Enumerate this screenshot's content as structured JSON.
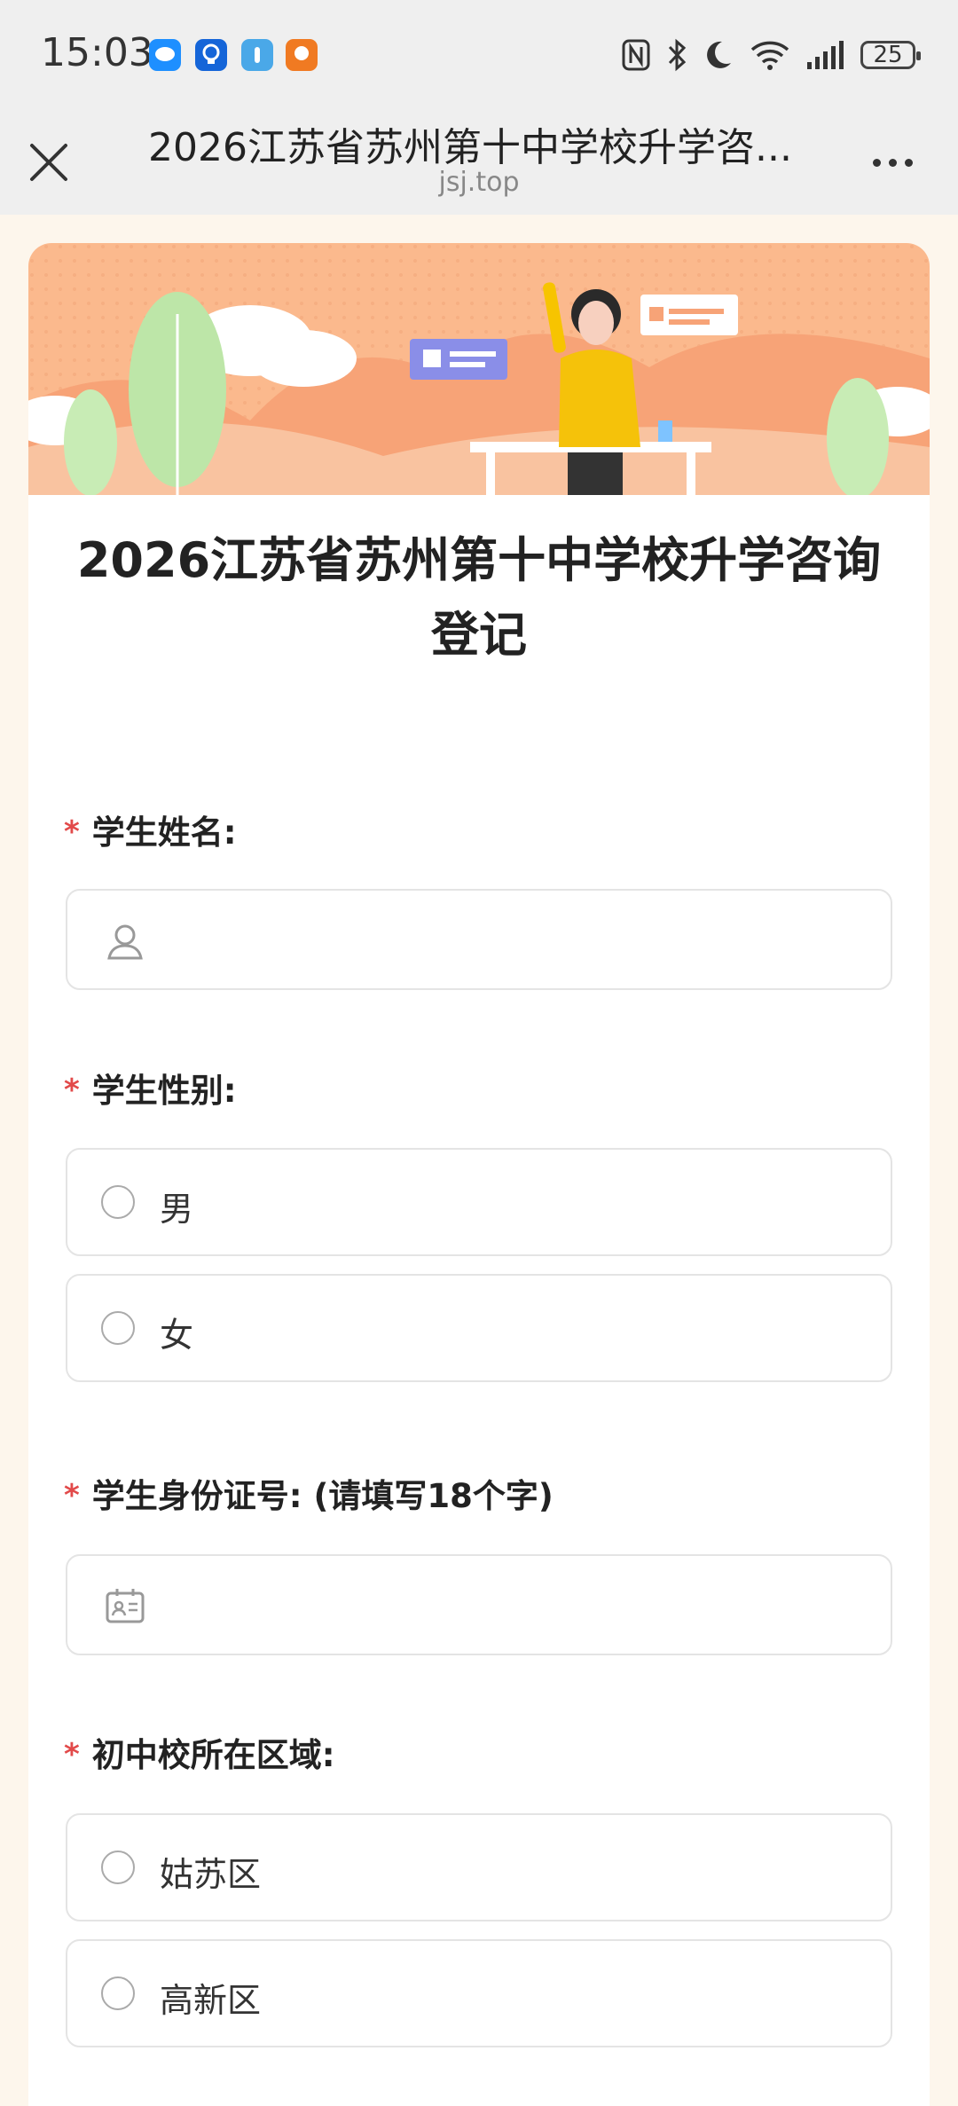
{
  "status_bar": {
    "time": "15:03",
    "battery": "25",
    "icons": [
      "message-app-icon",
      "bulb-app-icon",
      "meeting-app-icon",
      "orange-app-icon",
      "nfc-icon",
      "bluetooth-icon",
      "moon-icon",
      "wifi-icon",
      "signal-icon",
      "battery-icon"
    ]
  },
  "navbar": {
    "title": "2026江苏省苏州第十中学校升学咨...",
    "subtitle": "jsj.top"
  },
  "form": {
    "title": "2026江苏省苏州第十中学校升学咨询登记",
    "questions": [
      {
        "label": "学生姓名:",
        "required": "*"
      },
      {
        "label": "学生性别:",
        "required": "*",
        "options": [
          "男",
          "女"
        ]
      },
      {
        "label": "学生身份证号: (请填写18个字)",
        "required": "*"
      },
      {
        "label": "初中校所在区域:",
        "required": "*",
        "options": [
          "姑苏区",
          "高新区"
        ]
      }
    ]
  },
  "colors": {
    "required_star": "#e24a4a",
    "banner_bg": "#fbb98d",
    "page_bg": "#fdf6ec"
  }
}
